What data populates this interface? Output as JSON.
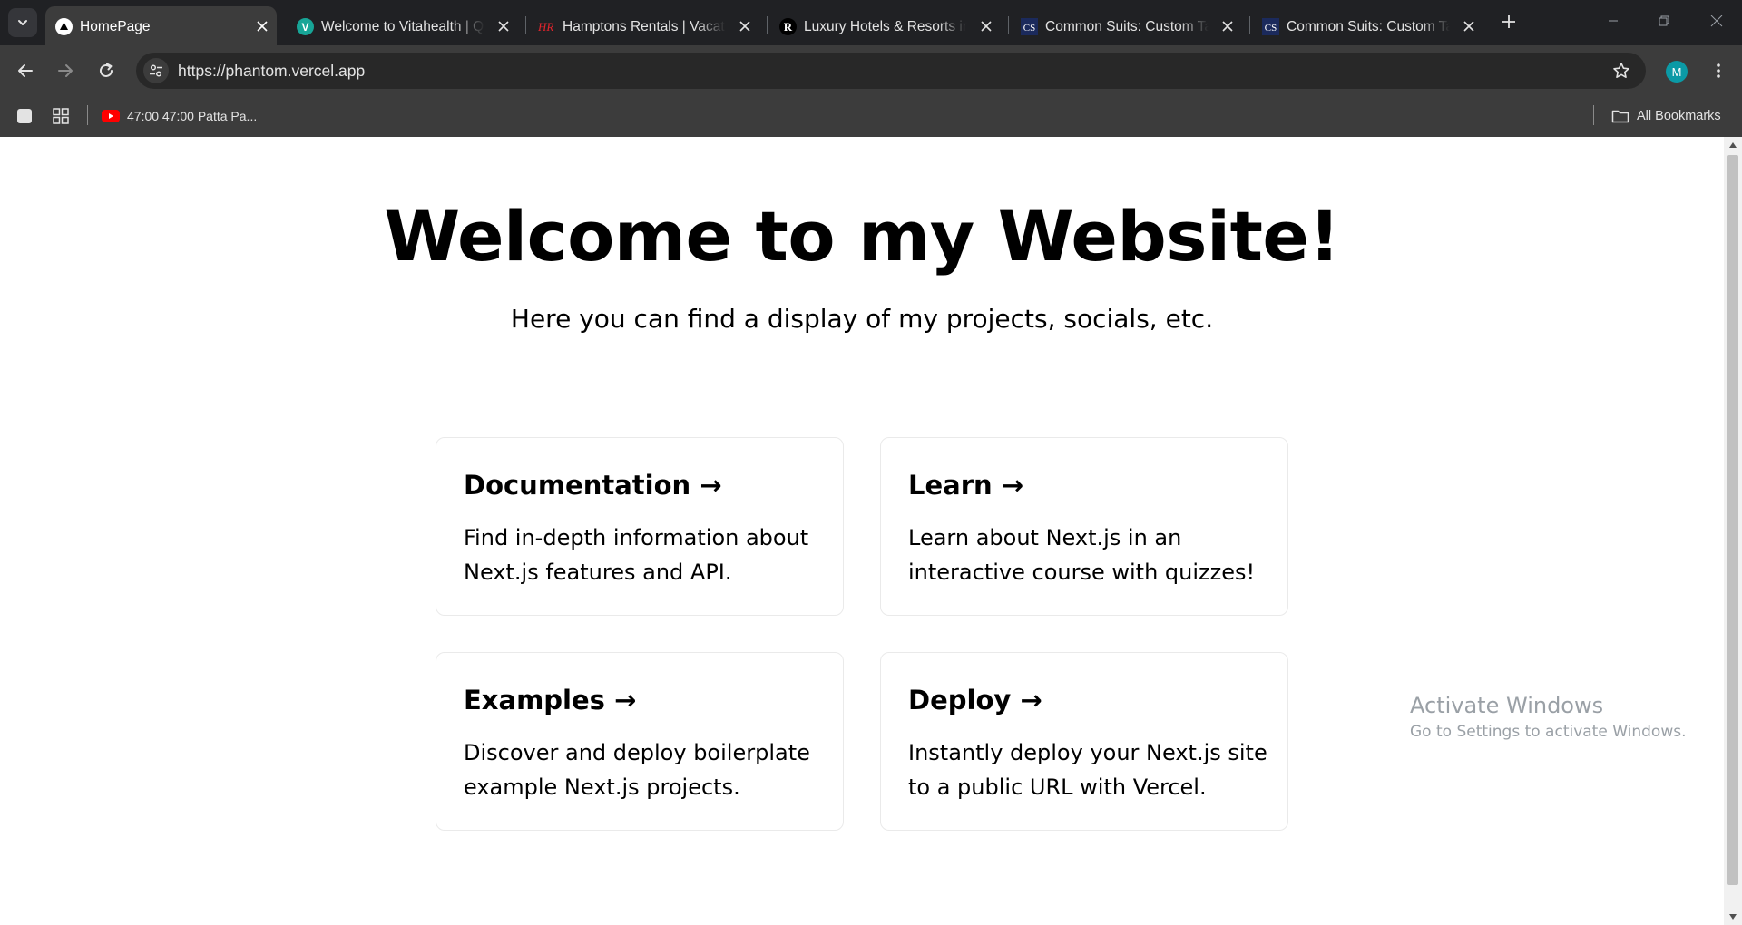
{
  "browser": {
    "tabs": [
      {
        "title": "HomePage",
        "favicon": "vercel-triangle-icon",
        "active": true
      },
      {
        "title": "Welcome to Vitahealth | Quiz",
        "favicon": "vitahealth-v-icon",
        "active": false
      },
      {
        "title": "Hamptons Rentals | Vacation Rentals",
        "favicon": "hr-logo-icon",
        "active": false
      },
      {
        "title": "Luxury Hotels & Resorts in",
        "favicon": "r-logo-icon",
        "active": false
      },
      {
        "title": "Common Suits: Custom Tailoring",
        "favicon": "cs-logo-icon",
        "active": false
      },
      {
        "title": "Common Suits: Custom Tailoring",
        "favicon": "cs-logo-icon",
        "active": false
      }
    ],
    "favicon_labels": {
      "vitahealth": "V",
      "hamptons": "HR",
      "luxury": "R",
      "common_suits": "CS"
    },
    "address_bar": {
      "url": "https://phantom.vercel.app"
    },
    "profile_initial": "M",
    "bookmarks": {
      "items": [
        {
          "label": "47:00 47:00 Patta Pa...",
          "icon": "youtube-icon"
        }
      ],
      "all_bookmarks_label": "All Bookmarks"
    },
    "colors": {
      "frame": "#202124",
      "toolbar": "#3c3c3c",
      "omnibox": "#282828",
      "accent": "#0b9aa6"
    }
  },
  "page": {
    "hero_title": "Welcome to my Website!",
    "hero_subtitle": "Here you can find a display of my projects, socials, etc.",
    "cards": [
      {
        "title": "Documentation →",
        "description": "Find in-depth information about Next.js features and API."
      },
      {
        "title": "Learn →",
        "description": "Learn about Next.js in an interactive course with quizzes!"
      },
      {
        "title": "Examples →",
        "description": "Discover and deploy boilerplate example Next.js projects."
      },
      {
        "title": "Deploy →",
        "description": "Instantly deploy your Next.js site to a public URL with Vercel."
      }
    ]
  },
  "os_overlay": {
    "activate_title": "Activate Windows",
    "activate_subtitle": "Go to Settings to activate Windows."
  }
}
